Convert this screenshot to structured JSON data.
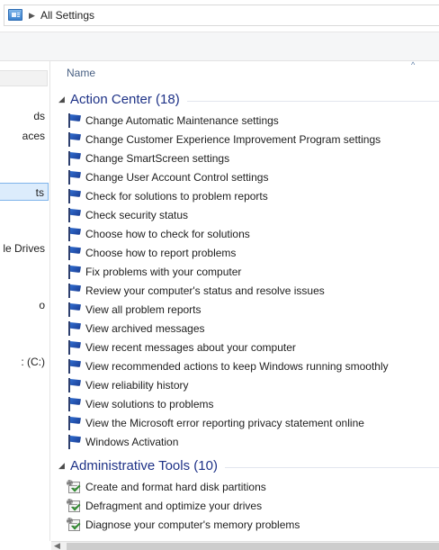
{
  "address_bar": {
    "icon": "control-panel-icon",
    "separator": "▶",
    "path": "All Settings"
  },
  "nav_pane": {
    "items": [
      {
        "label": "ds"
      },
      {
        "label": "aces"
      },
      {
        "label": "ts",
        "selected": true
      },
      {
        "label": "le Drives"
      },
      {
        "label": "o"
      },
      {
        "label": ": (C:)"
      }
    ]
  },
  "columns": {
    "name": "Name",
    "sort_glyph": "^"
  },
  "groups": [
    {
      "title": "Action Center (18)",
      "icon": "flag-icon",
      "items": [
        "Change Automatic Maintenance settings",
        "Change Customer Experience Improvement Program settings",
        "Change SmartScreen settings",
        "Change User Account Control settings",
        "Check for solutions to problem reports",
        "Check security status",
        "Choose how to check for solutions",
        "Choose how to report problems",
        "Fix problems with your computer",
        "Review your computer's status and resolve issues",
        "View all problem reports",
        "View archived messages",
        "View recent messages about your computer",
        "View recommended actions to keep Windows running smoothly",
        "View reliability history",
        "View solutions to problems",
        "View the Microsoft error reporting privacy statement online",
        "Windows Activation"
      ]
    },
    {
      "title": "Administrative Tools (10)",
      "icon": "admin-tools-icon",
      "items": [
        "Create and format hard disk partitions",
        "Defragment and optimize your drives",
        "Diagnose your computer's memory problems"
      ]
    }
  ],
  "scrollbar": {
    "left_arrow": "◀"
  }
}
